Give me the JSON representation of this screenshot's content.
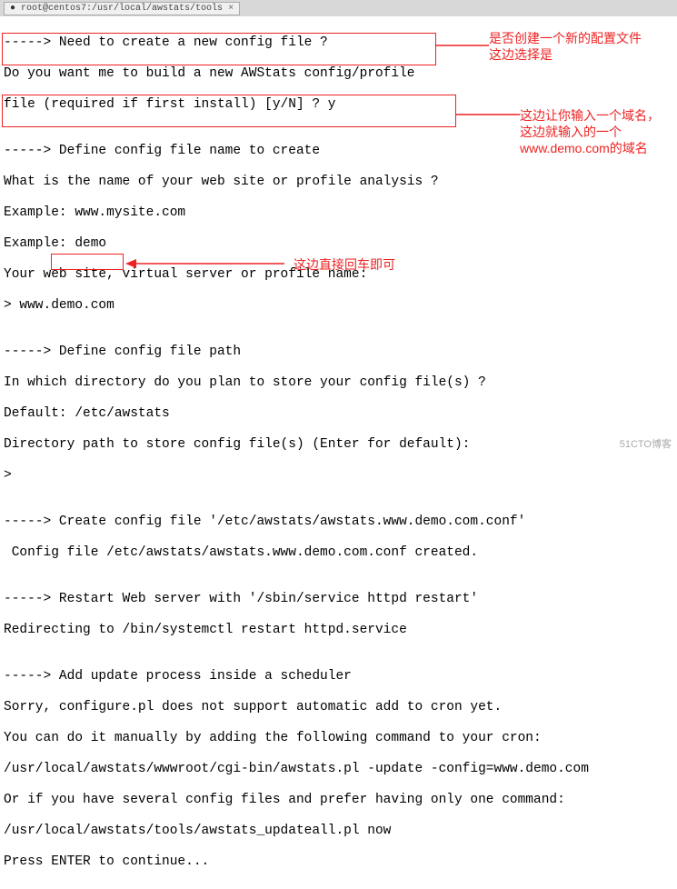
{
  "tab": {
    "title": "root@centos7:/usr/local/awstats/tools",
    "close": "×"
  },
  "lines": {
    "l1": "-----> Need to create a new config file ?",
    "l2": "Do you want me to build a new AWStats config/profile",
    "l3": "file (required if first install) [y/N] ? y",
    "l4": "",
    "l5": "-----> Define config file name to create",
    "l6": "What is the name of your web site or profile analysis ?",
    "l7": "Example: www.mysite.com",
    "l8": "Example: demo",
    "l9": "Your web site, virtual server or profile name:",
    "l10": "> www.demo.com",
    "l11": "",
    "l12": "-----> Define config file path",
    "l13": "In which directory do you plan to store your config file(s) ?",
    "l14": "Default: /etc/awstats",
    "l15": "Directory path to store config file(s) (Enter for default):",
    "l16": ">",
    "l17": "",
    "l18": "-----> Create config file '/etc/awstats/awstats.www.demo.com.conf'",
    "l19": " Config file /etc/awstats/awstats.www.demo.com.conf created.",
    "l20": "",
    "l21": "-----> Restart Web server with '/sbin/service httpd restart'",
    "l22": "Redirecting to /bin/systemctl restart httpd.service",
    "l23": "",
    "l24": "-----> Add update process inside a scheduler",
    "l25": "Sorry, configure.pl does not support automatic add to cron yet.",
    "l26": "You can do it manually by adding the following command to your cron:",
    "l27": "/usr/local/awstats/wwwroot/cgi-bin/awstats.pl -update -config=www.demo.com",
    "l28": "Or if you have several config files and prefer having only one command:",
    "l29": "/usr/local/awstats/tools/awstats_updateall.pl now",
    "l30": "Press ENTER to continue..."
  },
  "annotations": {
    "a1": "是否创建一个新的配置文件\n这边选择是",
    "a2": "这边让你输入一个域名，\n这边就输入的一个\nwww.demo.com的域名",
    "a3": "这边直接回车即可"
  },
  "watermark": "51CTO博客"
}
